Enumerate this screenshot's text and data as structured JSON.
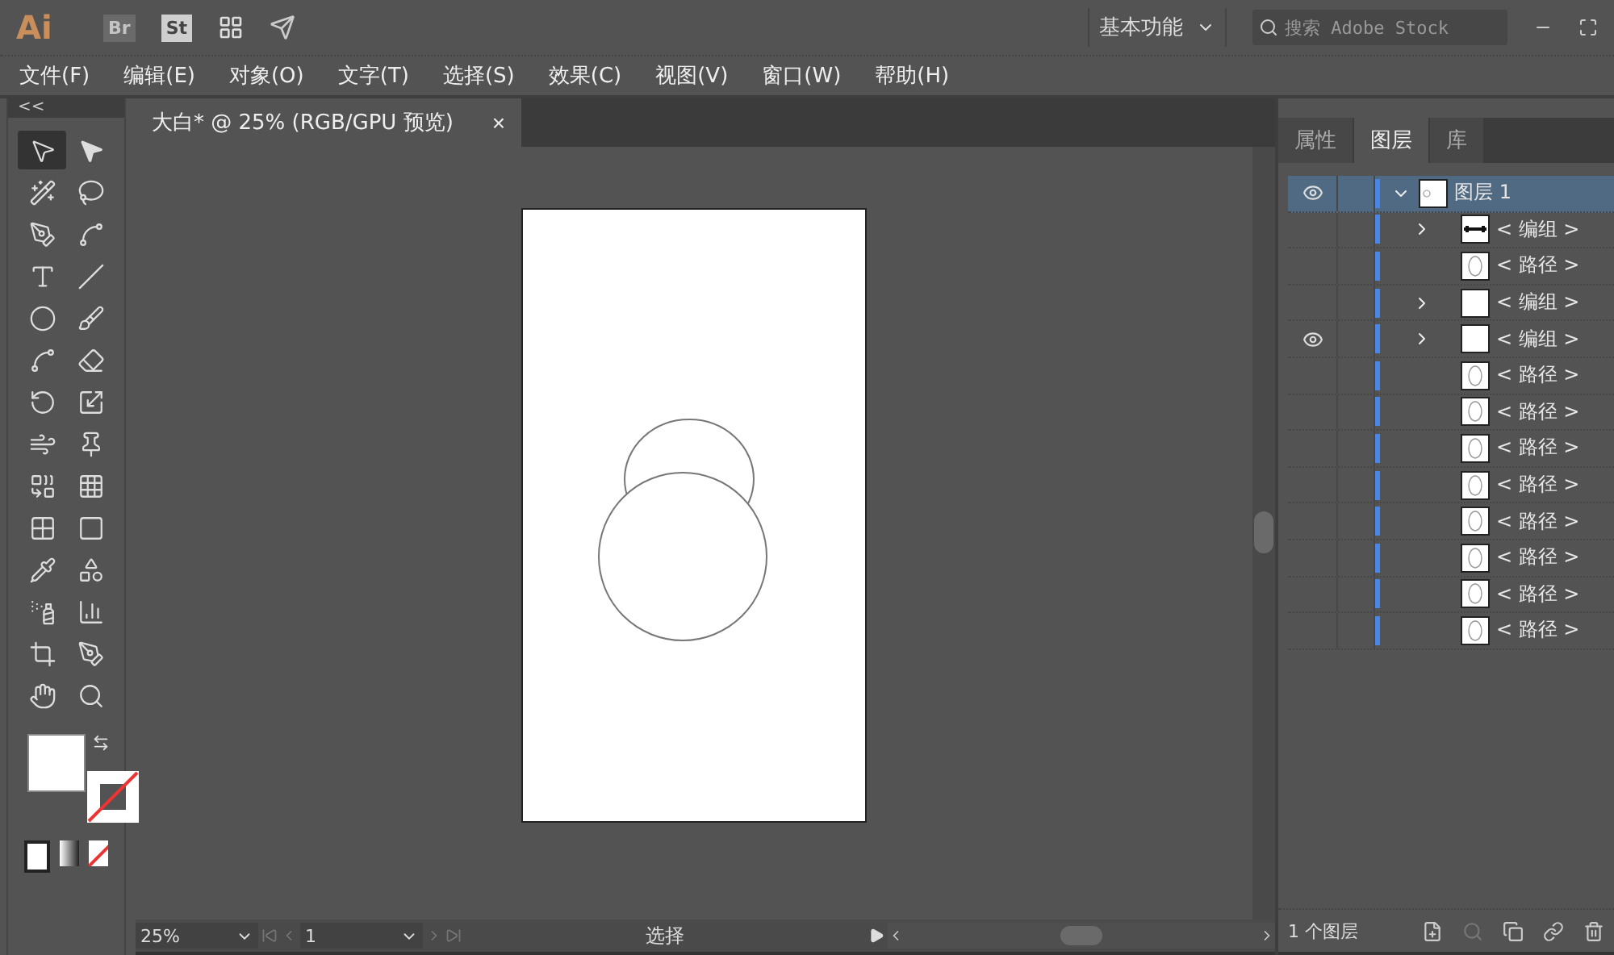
{
  "app_bar": {
    "logo": "Ai",
    "bridge": "Br",
    "stock": "St",
    "workspace": "基本功能",
    "search": {
      "placeholder": "搜索 Adobe Stock"
    }
  },
  "menu": [
    "文件(F)",
    "编辑(E)",
    "对象(O)",
    "文字(T)",
    "选择(S)",
    "效果(C)",
    "视图(V)",
    "窗口(W)",
    "帮助(H)"
  ],
  "toolbar": {
    "collapse": "<<",
    "tools": [
      {
        "kind": "select",
        "selected": true
      },
      {
        "kind": "direct",
        "selected": false
      },
      {
        "kind": "wand",
        "selected": false
      },
      {
        "kind": "lasso",
        "selected": false
      },
      {
        "kind": "pen",
        "selected": false
      },
      {
        "kind": "curvature",
        "selected": false
      },
      {
        "kind": "type",
        "selected": false
      },
      {
        "kind": "line",
        "selected": false
      },
      {
        "kind": "ellipse",
        "selected": false
      },
      {
        "kind": "brush",
        "selected": false
      },
      {
        "kind": "shaper",
        "selected": false
      },
      {
        "kind": "eraser",
        "selected": false
      },
      {
        "kind": "rotate",
        "selected": false
      },
      {
        "kind": "scale",
        "selected": false
      },
      {
        "kind": "warp",
        "selected": false
      },
      {
        "kind": "pin",
        "selected": false
      },
      {
        "kind": "shapebuilder",
        "selected": false
      },
      {
        "kind": "perspective",
        "selected": false
      },
      {
        "kind": "mesh",
        "selected": false
      },
      {
        "kind": "gradient",
        "selected": false
      },
      {
        "kind": "eyedropper",
        "selected": false
      },
      {
        "kind": "blend",
        "selected": false
      },
      {
        "kind": "symbol",
        "selected": false
      },
      {
        "kind": "graph",
        "selected": false
      },
      {
        "kind": "artboard",
        "selected": false
      },
      {
        "kind": "knife",
        "selected": false
      },
      {
        "kind": "hand",
        "selected": false
      },
      {
        "kind": "zoom",
        "selected": false
      }
    ]
  },
  "document": {
    "tab_title": "大白* @ 25% (RGB/GPU 预览)",
    "close": "×"
  },
  "status_bar": {
    "zoom": "25%",
    "artboard": "1",
    "tool": "选择"
  },
  "panel": {
    "tabs": [
      {
        "label": "属性",
        "selected": false
      },
      {
        "label": "图层",
        "selected": true
      },
      {
        "label": "库",
        "selected": false
      }
    ],
    "layers": [
      {
        "name": "图层 1",
        "visible": true,
        "expanded": true,
        "children": [
          {
            "name": "< 编组 >",
            "kind": "group",
            "visible": false
          },
          {
            "name": "< 路径 >",
            "kind": "path",
            "visible": false
          },
          {
            "name": "< 编组 >",
            "kind": "group",
            "visible": false
          },
          {
            "name": "< 编组 >",
            "kind": "group",
            "visible": true
          },
          {
            "name": "< 路径 >",
            "kind": "path",
            "visible": false
          },
          {
            "name": "< 路径 >",
            "kind": "path",
            "visible": false
          },
          {
            "name": "< 路径 >",
            "kind": "path",
            "visible": false
          },
          {
            "name": "< 路径 >",
            "kind": "path",
            "visible": false
          },
          {
            "name": "< 路径 >",
            "kind": "path",
            "visible": false
          },
          {
            "name": "< 路径 >",
            "kind": "path",
            "visible": false
          },
          {
            "name": "< 路径 >",
            "kind": "path",
            "visible": false
          },
          {
            "name": "< 路径 >",
            "kind": "path",
            "visible": false
          }
        ]
      }
    ],
    "layer_count": "1 个图层"
  }
}
